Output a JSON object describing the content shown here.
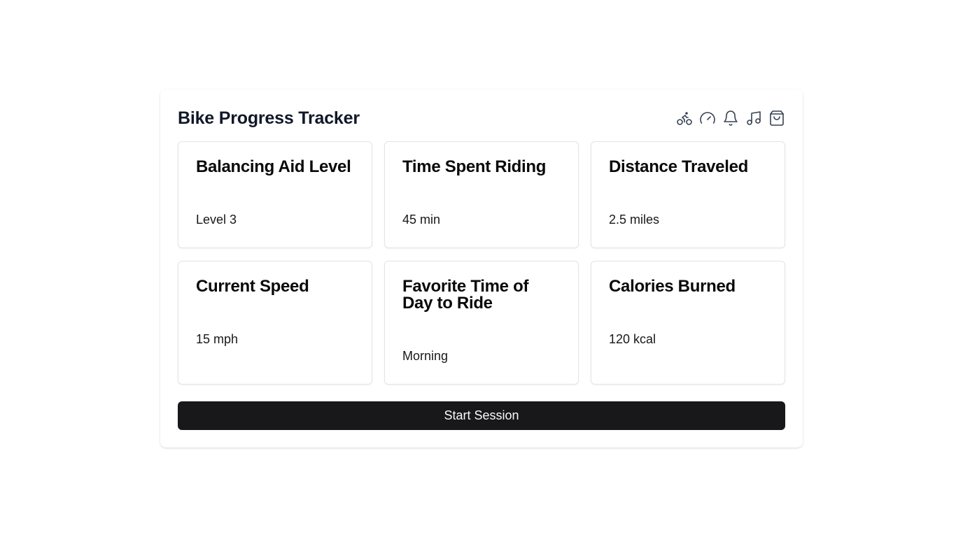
{
  "header": {
    "title": "Bike Progress Tracker",
    "icons": [
      "bike-icon",
      "speedometer-icon",
      "bell-icon",
      "music-icon",
      "shopping-bag-icon"
    ]
  },
  "cards": [
    {
      "title": "Balancing Aid Level",
      "value": "Level 3"
    },
    {
      "title": "Time Spent Riding",
      "value": "45 min"
    },
    {
      "title": "Distance Traveled",
      "value": "2.5 miles"
    },
    {
      "title": "Current Speed",
      "value": "15 mph"
    },
    {
      "title": "Favorite Time of Day to Ride",
      "value": "Morning"
    },
    {
      "title": "Calories Burned",
      "value": "120 kcal"
    }
  ],
  "actions": {
    "start_label": "Start Session"
  },
  "colors": {
    "primary_button": "#18181b",
    "card_border": "#e4e4e7",
    "icon_stroke": "#374151"
  }
}
